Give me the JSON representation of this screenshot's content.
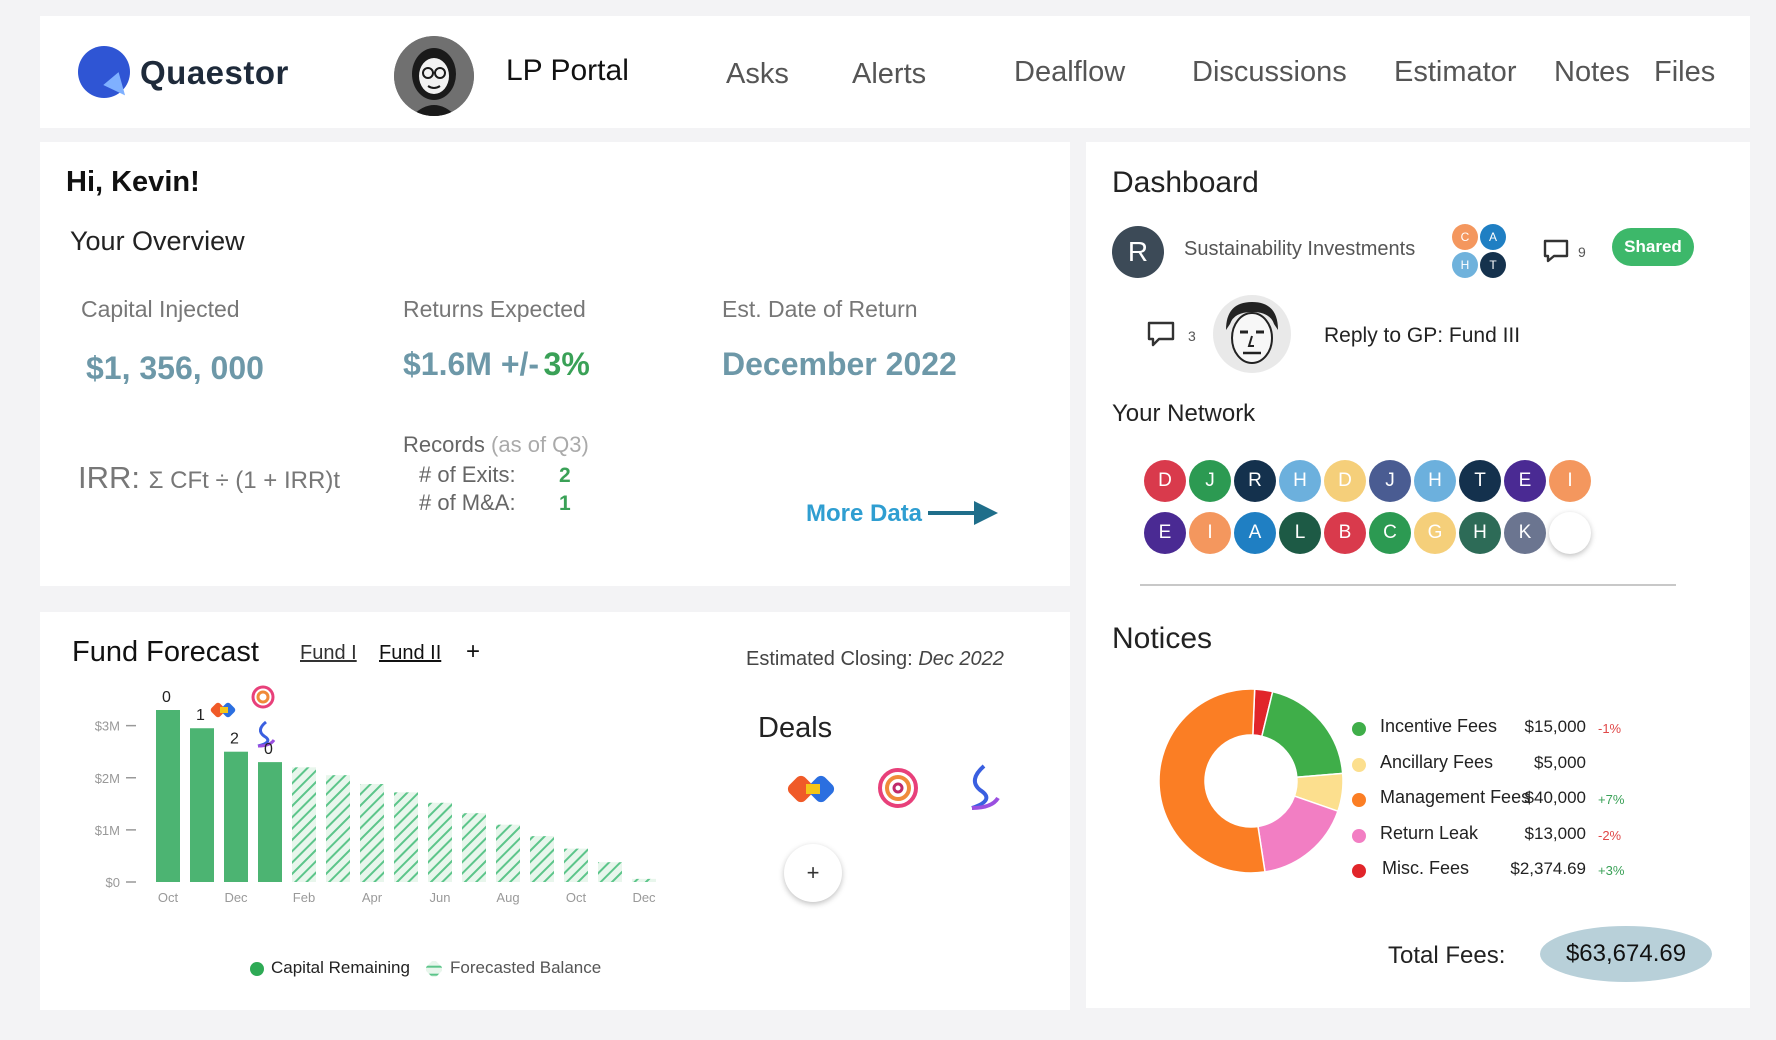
{
  "header": {
    "brand": "Quaestor",
    "portal_title": "LP Portal",
    "nav": [
      "Asks",
      "Alerts",
      "Dealflow",
      "Discussions",
      "Estimator",
      "Notes",
      "Files"
    ]
  },
  "overview": {
    "greeting": "Hi, Kevin!",
    "title": "Your Overview",
    "capital_label": "Capital Injected",
    "capital_value": "$1, 356, 000",
    "returns_label": "Returns Expected",
    "returns_value": "$1.6M +/-",
    "returns_pct": "3%",
    "date_label": "Est. Date of Return",
    "date_value": "December 2022",
    "irr_label": "IRR:",
    "irr_formula": "Σ CFt ÷ (1 + IRR)t",
    "records_label": "Records",
    "records_note": "(as of Q3)",
    "exits_label": "# of Exits:",
    "exits_value": "2",
    "ma_label": "# of M&A:",
    "ma_value": "1",
    "more_data": "More Data"
  },
  "forecast": {
    "title": "Fund Forecast",
    "tabs": [
      "Fund I",
      "Fund II"
    ],
    "add": "+",
    "closing_label": "Estimated Closing:",
    "closing_value": "Dec 2022",
    "deals_title": "Deals",
    "deals_add": "+",
    "legend": [
      "Capital Remaining",
      "Forecasted Balance"
    ]
  },
  "chart_data": {
    "type": "bar",
    "ylabel": "",
    "xlabel": "",
    "ylim": [
      0,
      3.3
    ],
    "y_ticks": [
      "$0",
      "$1M",
      "$2M",
      "$3M"
    ],
    "x_tick_labels": [
      "Oct",
      "Dec",
      "Feb",
      "Apr",
      "Jun",
      "Aug",
      "Oct",
      "Dec"
    ],
    "series": [
      {
        "name": "Capital Remaining",
        "values": [
          3.3,
          2.95,
          2.5,
          2.3,
          null,
          null,
          null,
          null,
          null,
          null,
          null,
          null,
          null,
          null,
          null
        ]
      },
      {
        "name": "Forecasted Balance",
        "values": [
          null,
          null,
          null,
          null,
          2.2,
          2.05,
          1.88,
          1.72,
          1.52,
          1.32,
          1.1,
          0.88,
          0.64,
          0.38,
          0.06
        ]
      }
    ],
    "annotations": [
      {
        "index": 0,
        "text": "0"
      },
      {
        "index": 1,
        "text": "1"
      },
      {
        "index": 2,
        "text": "2"
      },
      {
        "index": 3,
        "text": "0"
      }
    ],
    "grid": false,
    "legend_position": "bottom"
  },
  "dashboard": {
    "title": "Dashboard",
    "item_avatar": "R",
    "item_name": "Sustainability Investments",
    "members": [
      {
        "letter": "C",
        "color": "#f4975e"
      },
      {
        "letter": "A",
        "color": "#1f7fc3"
      },
      {
        "letter": "H",
        "color": "#6fb2dc"
      },
      {
        "letter": "T",
        "color": "#15324d"
      }
    ],
    "comments_1": "9",
    "shared": "Shared",
    "comments_2": "3",
    "reply": "Reply to GP: Fund III",
    "network_title": "Your Network",
    "network_row1": [
      {
        "l": "D",
        "c": "#d93a4c"
      },
      {
        "l": "J",
        "c": "#2c9a52"
      },
      {
        "l": "R",
        "c": "#14314d"
      },
      {
        "l": "H",
        "c": "#6cb0dd"
      },
      {
        "l": "D",
        "c": "#f5cf7a"
      },
      {
        "l": "J",
        "c": "#4a5c92"
      },
      {
        "l": "H",
        "c": "#6cb0dd"
      },
      {
        "l": "T",
        "c": "#14314d"
      },
      {
        "l": "E",
        "c": "#4a2a93"
      },
      {
        "l": "I",
        "c": "#f4975e"
      }
    ],
    "network_row2": [
      {
        "l": "E",
        "c": "#4a2a93"
      },
      {
        "l": "I",
        "c": "#f4975e"
      },
      {
        "l": "A",
        "c": "#1f7fc3"
      },
      {
        "l": "L",
        "c": "#1d5a45"
      },
      {
        "l": "B",
        "c": "#d93a4c"
      },
      {
        "l": "C",
        "c": "#2c9a52"
      },
      {
        "l": "G",
        "c": "#f5cf7a"
      },
      {
        "l": "H",
        "c": "#2d6b57"
      },
      {
        "l": "K",
        "c": "#6b7590"
      }
    ],
    "network_add": "+",
    "notices_title": "Notices",
    "fees": [
      {
        "label": "Incentive Fees",
        "value": "$15,000",
        "pct": "-1%",
        "color": "#3fae49",
        "amount": 15000
      },
      {
        "label": "Ancillary Fees",
        "value": "$5,000",
        "pct": "",
        "color": "#fcdf8e",
        "amount": 5000
      },
      {
        "label": "Management Fees",
        "value": "$40,000",
        "pct": "+7%",
        "color": "#fb7e24",
        "amount": 40000
      },
      {
        "label": "Return Leak",
        "value": "$13,000",
        "pct": "-2%",
        "color": "#f27ec3",
        "amount": 13000
      },
      {
        "label": "Misc. Fees",
        "value": "$2,374.69",
        "pct": "+3%",
        "color": "#e1252a",
        "amount": 2374.69
      }
    ],
    "total_label": "Total Fees:",
    "total_value": "$63,674.69"
  },
  "colors": {
    "accent": "#2f9ed1",
    "value_teal": "#6d98a8",
    "green": "#3aa157",
    "shared_green": "#3db86a",
    "bar_green": "#4cb472",
    "pie_blue": "#2f7db8"
  }
}
